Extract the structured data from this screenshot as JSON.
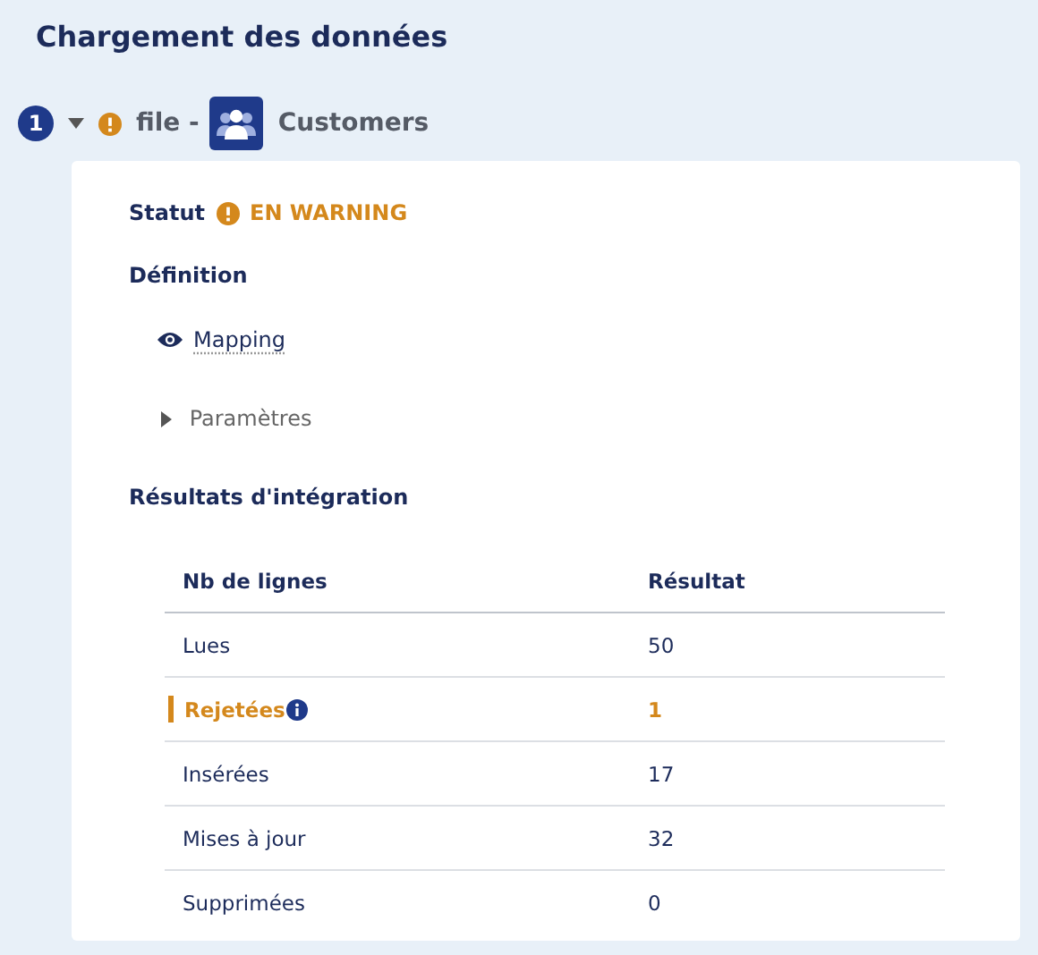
{
  "title": "Chargement des données",
  "step": {
    "number": "1",
    "expanded": true,
    "warning": true,
    "name": "file -",
    "source": "Customers"
  },
  "status": {
    "label": "Statut",
    "value": "EN WARNING"
  },
  "definition": {
    "label": "Définition",
    "mapping": "Mapping",
    "parameters": {
      "label": "Paramètres",
      "expanded": false
    }
  },
  "results": {
    "title": "Résultats d'intégration",
    "columns": [
      "Nb de lignes",
      "Résultat"
    ],
    "rows": [
      {
        "label": "Lues",
        "value": "50",
        "warning": false
      },
      {
        "label": "Rejetées",
        "value": "1",
        "warning": true
      },
      {
        "label": "Insérées",
        "value": "17",
        "warning": false
      },
      {
        "label": "Mises à jour",
        "value": "32",
        "warning": false
      },
      {
        "label": "Supprimées",
        "value": "0",
        "warning": false
      }
    ]
  }
}
